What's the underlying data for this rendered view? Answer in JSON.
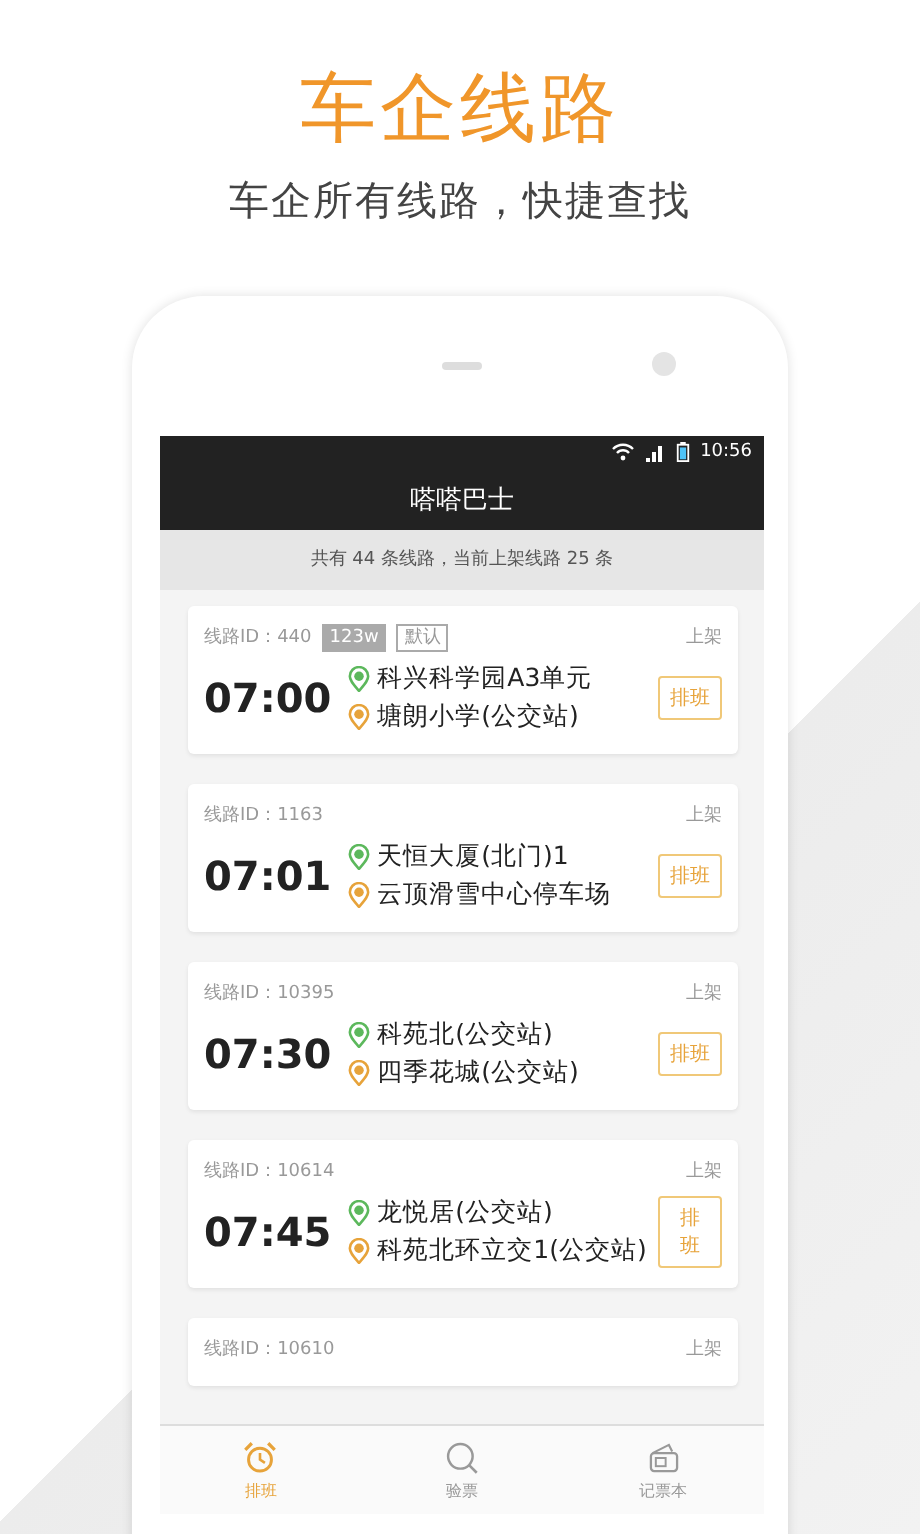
{
  "headline": "车企线路",
  "subheadline": "车企所有线路，快捷查找",
  "status_bar": {
    "time": "10:56"
  },
  "app_bar": {
    "title": "嗒嗒巴士"
  },
  "summary": "共有 44 条线路，当前上架线路 25 条",
  "routes": [
    {
      "id_label": "线路ID：440",
      "tags": [
        {
          "text": "123w",
          "kind": "filled"
        },
        {
          "text": "默认",
          "kind": "outline"
        }
      ],
      "status": "上架",
      "time": "07:00",
      "start": "科兴科学园A3单元",
      "end": "塘朗小学(公交站)",
      "action": "排班"
    },
    {
      "id_label": "线路ID：1163",
      "status": "上架",
      "time": "07:01",
      "start": "天恒大厦(北门)1",
      "end": "云顶滑雪中心停车场",
      "action": "排班"
    },
    {
      "id_label": "线路ID：10395",
      "status": "上架",
      "time": "07:30",
      "start": "科苑北(公交站)",
      "end": "四季花城(公交站)",
      "action": "排班"
    },
    {
      "id_label": "线路ID：10614",
      "status": "上架",
      "time": "07:45",
      "start": "龙悦居(公交站)",
      "end": "科苑北环立交1(公交站)",
      "action": "排班"
    },
    {
      "id_label": "线路ID：10610",
      "status": "上架"
    }
  ],
  "tabs": [
    {
      "label": "排班",
      "kind": "alarm",
      "selected": true
    },
    {
      "label": "验票",
      "kind": "search",
      "selected": false
    },
    {
      "label": "记票本",
      "kind": "wallet",
      "selected": false
    }
  ]
}
